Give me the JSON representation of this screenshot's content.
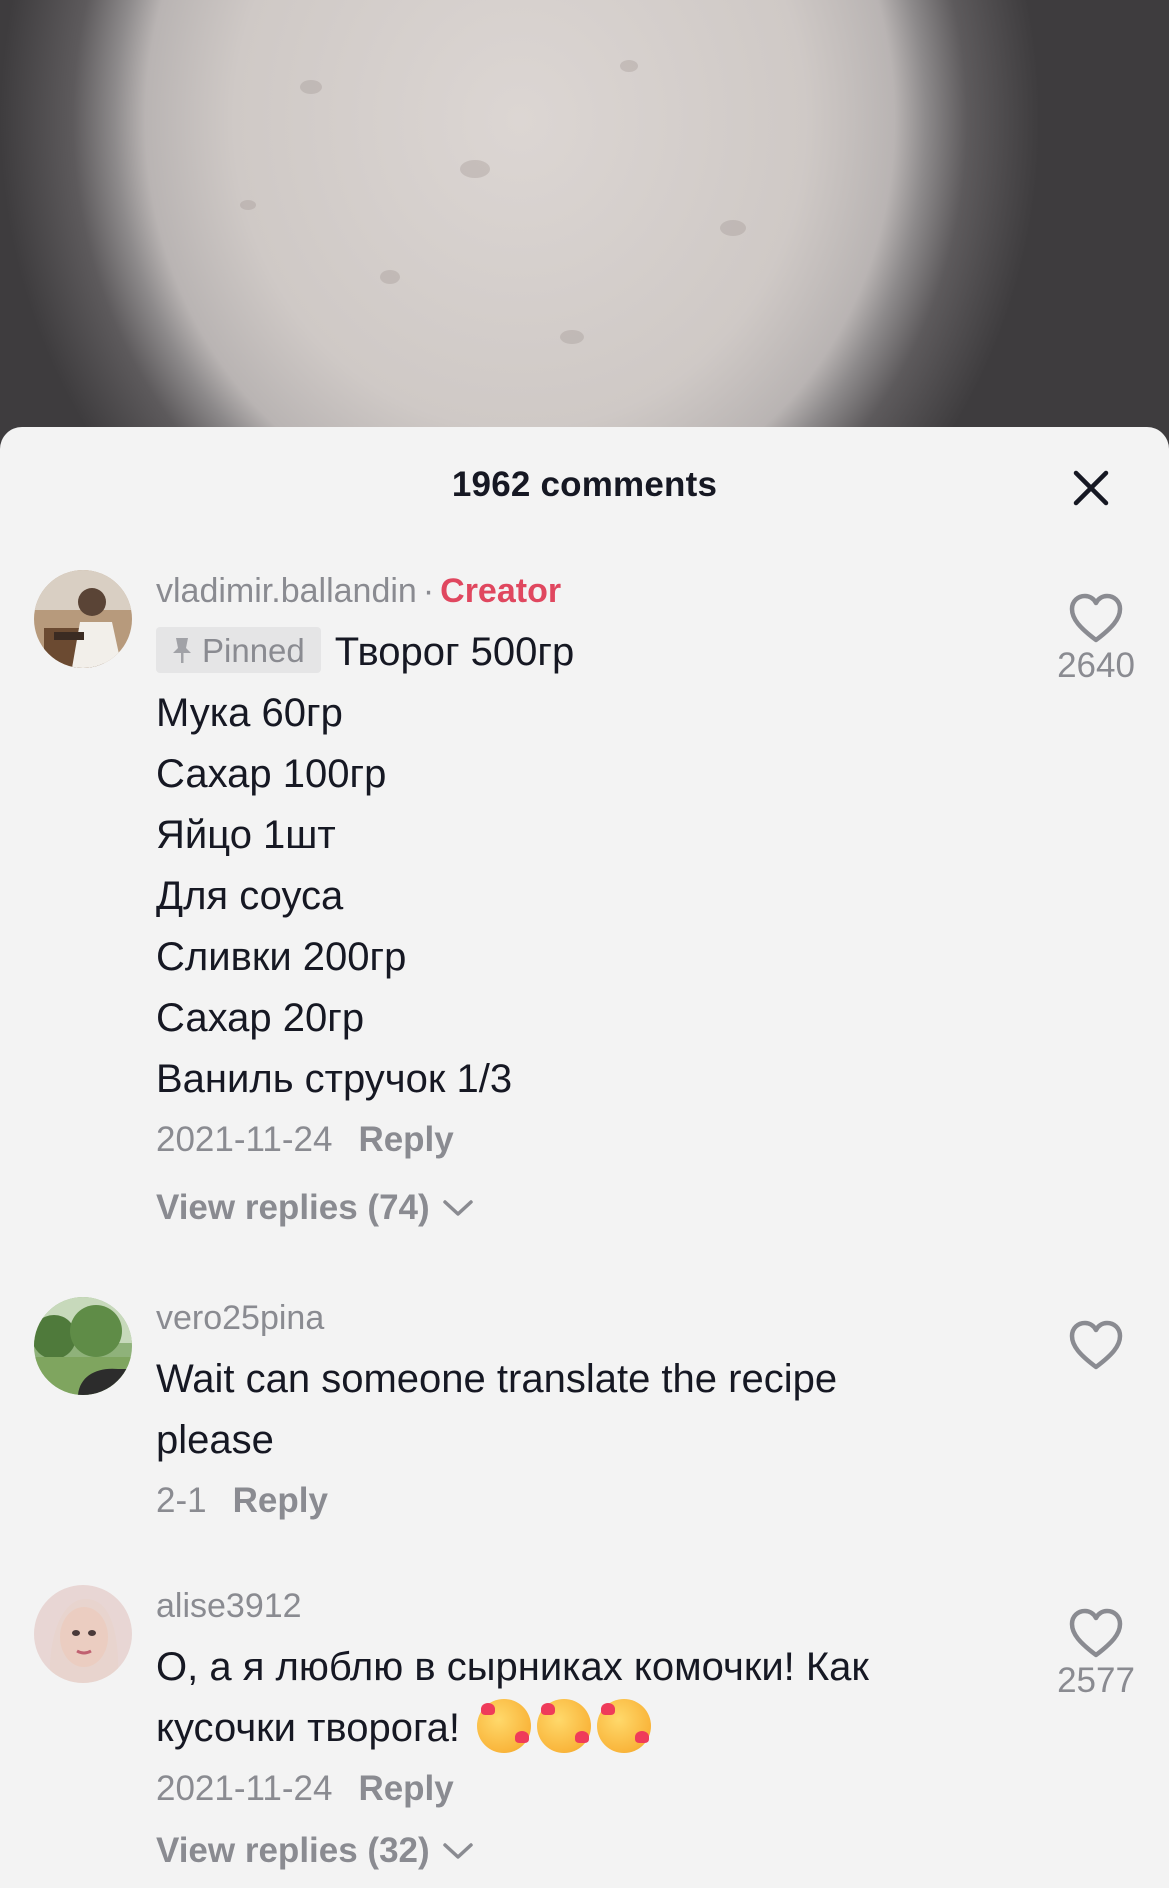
{
  "header": {
    "comment_count": "1962 comments"
  },
  "comments": [
    {
      "username": "vladimir.ballandin",
      "separator": "·",
      "badge": "Creator",
      "pinned_label": "Pinned",
      "lines": [
        "Творог 500гр",
        "Мука 60гр",
        "Сахар 100гр",
        "Яйцо 1шт",
        "Для соуса",
        "Сливки 200гр",
        "Сахар 20гр",
        "Ваниль стручок 1/3"
      ],
      "date": "2021-11-24",
      "reply_label": "Reply",
      "view_replies": "View replies (74)",
      "likes": "2640"
    },
    {
      "username": "vero25pina",
      "lines": [
        "Wait can someone translate the recipe",
        "please"
      ],
      "date": "2-1",
      "reply_label": "Reply",
      "likes": ""
    },
    {
      "username": "alise3912",
      "lines": [
        "О, а я люблю в сырниках комочки! Как",
        "кусочки творога!"
      ],
      "emoji": "smiling-face-with-hearts",
      "date": "2021-11-24",
      "reply_label": "Reply",
      "view_replies": "View replies (32)",
      "likes": "2577"
    }
  ],
  "icons": {
    "close": "close-icon",
    "like": "heart-outline-icon",
    "pin": "pin-icon",
    "chevron": "chevron-down-icon"
  },
  "colors": {
    "creator_badge": "#e0475f",
    "sheet_background": "#f3f3f3",
    "muted_text": "#8a8b91",
    "primary_text": "#161823"
  }
}
